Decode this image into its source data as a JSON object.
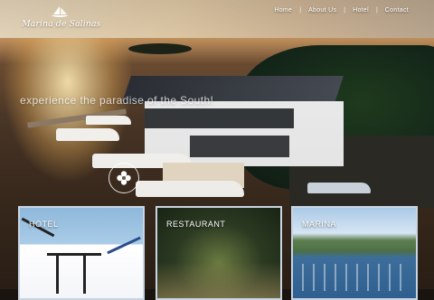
{
  "brand": {
    "name": "Marina de Salinas"
  },
  "nav": {
    "items": [
      "Home",
      "About Us",
      "Hotel",
      "Contact"
    ],
    "separator": "|"
  },
  "hero": {
    "tagline": "experience the paradise of the South!"
  },
  "cards": [
    {
      "label": "HOTEL"
    },
    {
      "label": "RESTAURANT"
    },
    {
      "label": "MARINA"
    }
  ],
  "colors": {
    "card_border": "#c9d5e2",
    "text": "#ffffff"
  },
  "icons": {
    "logo": "sailboat-icon",
    "emblem": "flower-emblem-icon"
  }
}
